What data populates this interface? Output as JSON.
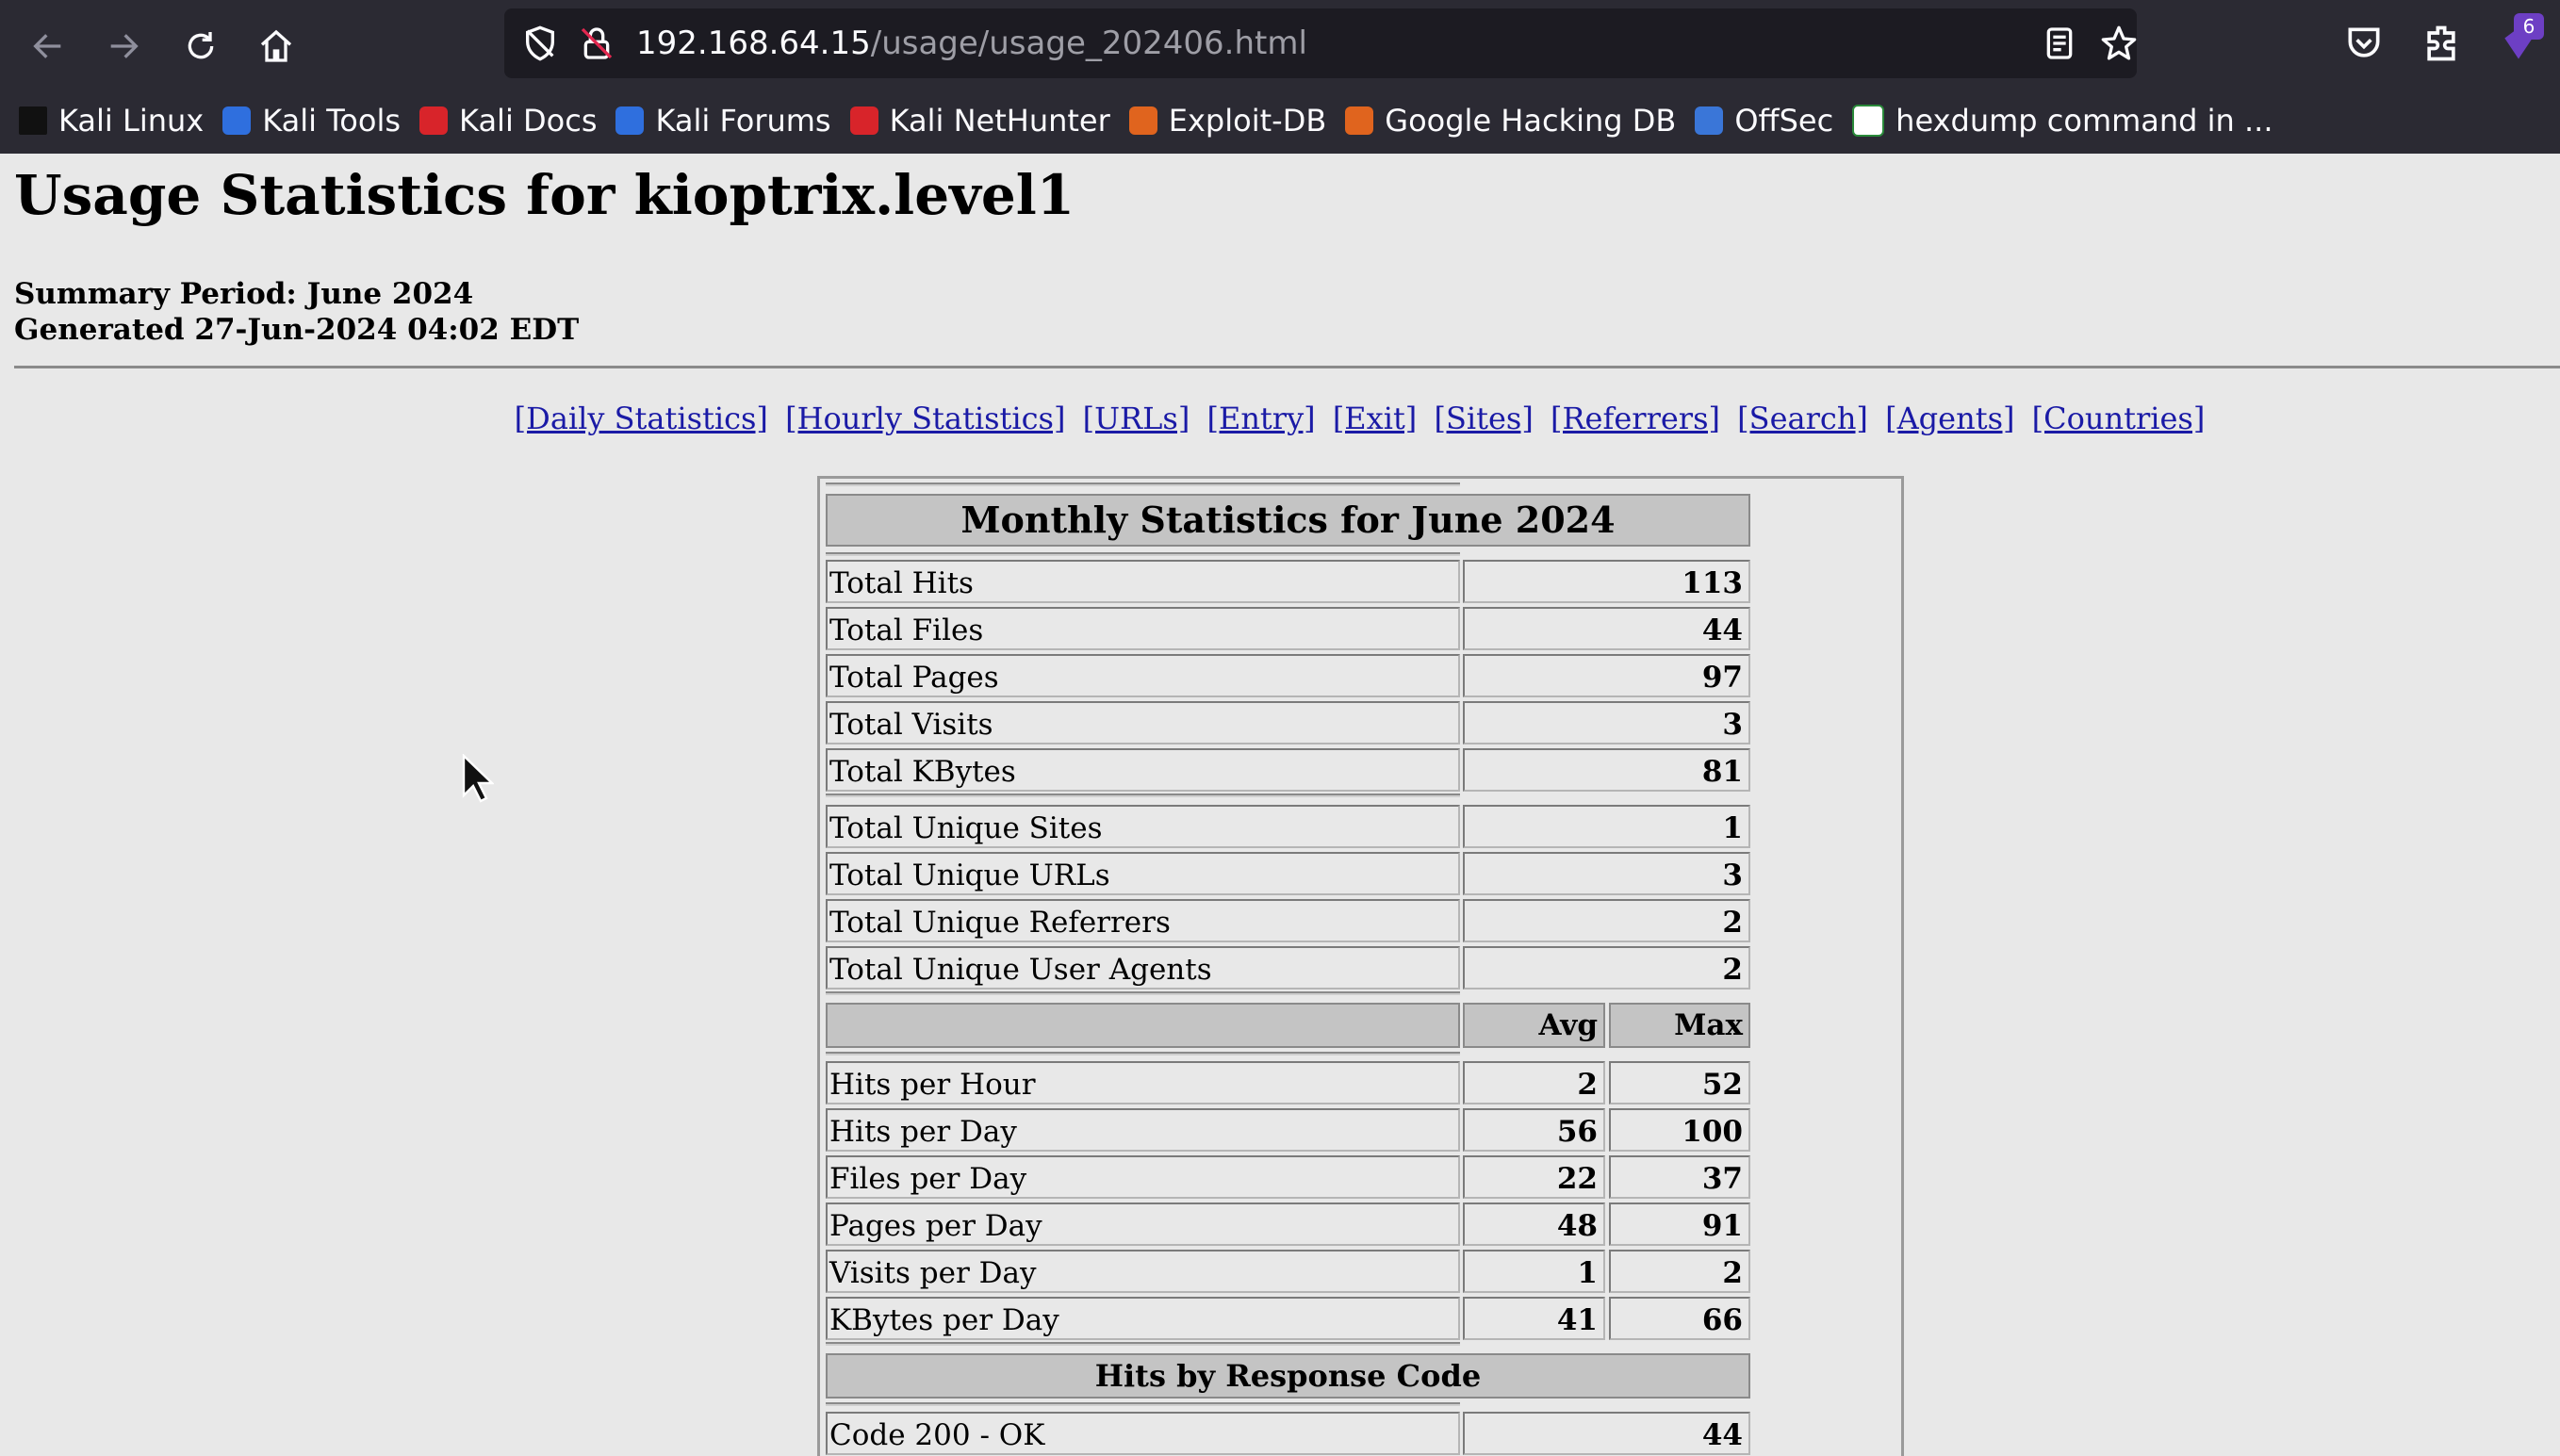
{
  "browser": {
    "url_host": "192.168.64.15",
    "url_path": "/usage/usage_202406.html",
    "extension_badge": "6"
  },
  "bookmarks": [
    {
      "label": "Kali Linux",
      "icon": "kali-dragon-icon"
    },
    {
      "label": "Kali Tools",
      "icon": "kali-tools-icon"
    },
    {
      "label": "Kali Docs",
      "icon": "kali-docs-icon"
    },
    {
      "label": "Kali Forums",
      "icon": "kali-forums-icon"
    },
    {
      "label": "Kali NetHunter",
      "icon": "kali-nethunter-icon"
    },
    {
      "label": "Exploit-DB",
      "icon": "exploit-db-icon"
    },
    {
      "label": "Google Hacking DB",
      "icon": "ghdb-icon"
    },
    {
      "label": "OffSec",
      "icon": "offsec-icon"
    },
    {
      "label": "hexdump command in ...",
      "icon": "hexdump-icon"
    }
  ],
  "page": {
    "title": "Usage Statistics for kioptrix.level1",
    "summary_period": "Summary Period: June 2024",
    "generated": "Generated 27-Jun-2024 04:02 EDT",
    "nav_links": [
      "[Daily Statistics]",
      "[Hourly Statistics]",
      "[URLs]",
      "[Entry]",
      "[Exit]",
      "[Sites]",
      "[Referrers]",
      "[Search]",
      "[Agents]",
      "[Countries]"
    ]
  },
  "stats": {
    "title": "Monthly Statistics for June 2024",
    "totals": [
      {
        "label": "Total Hits",
        "value": "113"
      },
      {
        "label": "Total Files",
        "value": "44"
      },
      {
        "label": "Total Pages",
        "value": "97"
      },
      {
        "label": "Total Visits",
        "value": "3"
      },
      {
        "label": "Total KBytes",
        "value": "81"
      }
    ],
    "uniques": [
      {
        "label": "Total Unique Sites",
        "value": "1"
      },
      {
        "label": "Total Unique URLs",
        "value": "3"
      },
      {
        "label": "Total Unique Referrers",
        "value": "2"
      },
      {
        "label": "Total Unique User Agents",
        "value": "2"
      }
    ],
    "avg_header": "Avg",
    "max_header": "Max",
    "rates": [
      {
        "label": "Hits per Hour",
        "avg": "2",
        "max": "52"
      },
      {
        "label": "Hits per Day",
        "avg": "56",
        "max": "100"
      },
      {
        "label": "Files per Day",
        "avg": "22",
        "max": "37"
      },
      {
        "label": "Pages per Day",
        "avg": "48",
        "max": "91"
      },
      {
        "label": "Visits per Day",
        "avg": "1",
        "max": "2"
      },
      {
        "label": "KBytes per Day",
        "avg": "41",
        "max": "66"
      }
    ],
    "response_title": "Hits by Response Code",
    "response_codes": [
      {
        "label": "Code 200 - OK",
        "value": "44"
      }
    ]
  },
  "colors": {
    "chrome_bg": "#2b2a33",
    "urlbar_bg": "#1c1b22",
    "page_bg": "#e8e8e8",
    "link": "#1a1aa6",
    "header_bg": "#c4c4c4"
  }
}
